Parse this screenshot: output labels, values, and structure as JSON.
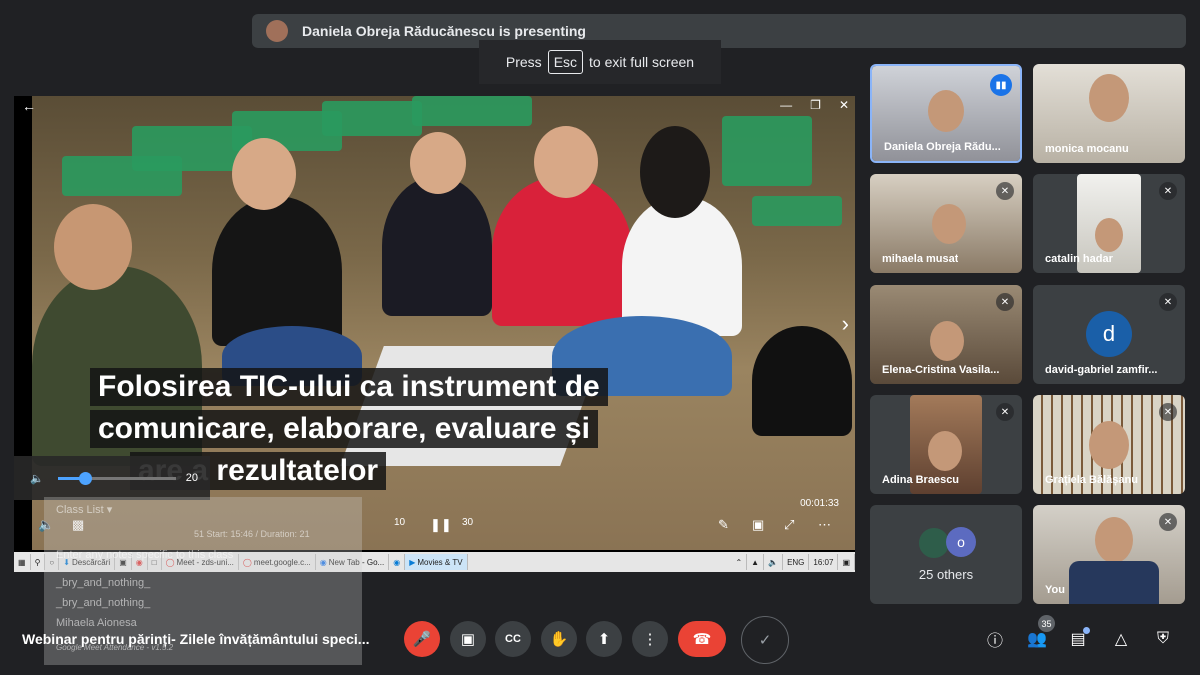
{
  "presenting_bar": {
    "text": "Daniela Obreja Răducănescu is presenting"
  },
  "fullscreen_banner": {
    "press": "Press",
    "key": "Esc",
    "suffix": "to exit full screen"
  },
  "video": {
    "caption_lines": [
      "Folosirea TIC-ului ca instrument de",
      "comunicare, elaborare, evaluare și",
      "are a rezultatelor"
    ],
    "volume_value": "20",
    "volume_level": 0.23,
    "time": "00:01:33",
    "skip_back": "10",
    "skip_forward": "30"
  },
  "attendance_panel": {
    "class_list_label": "Class List",
    "stats": "51  Start: 15:46 / Duration: 21",
    "notes_placeholder": "Enter any notes specific to this class",
    "rows": [
      "_bry_and_nothing_",
      "_bry_and_nothing_",
      "Mihaela Aionesa"
    ],
    "version": "Google Meet Attendance - v1.5.2"
  },
  "taskbar": {
    "items": [
      "Descărcări",
      "Meet - zds-uni...",
      "meet.google.c...",
      "New Tab - Go...",
      "Movies & TV"
    ],
    "lang": "ENG",
    "clock": "16:07"
  },
  "participants": [
    {
      "name": "Daniela Obreja Rădu...",
      "speaking": true
    },
    {
      "name": "monica mocanu"
    },
    {
      "name": "mihaela musat",
      "muted": true
    },
    {
      "name": "catalin hadar",
      "muted": true
    },
    {
      "name": "Elena-Cristina Vasila...",
      "muted": true
    },
    {
      "name": "david-gabriel zamfir...",
      "muted": true,
      "initial": "d",
      "avatar_color": "#1a5fa8"
    },
    {
      "name": "Adina Braescu",
      "muted": true
    },
    {
      "name": "Grațiela Bălășanu",
      "muted": true
    },
    {
      "name": "25 others",
      "initial": "o",
      "avatar_color": "#5c6bc0"
    },
    {
      "name": "You",
      "muted": true
    }
  ],
  "bottom_bar": {
    "meeting_title": "Webinar pentru părinți- Zilele învățământului speci...",
    "people_count": "35",
    "controls": [
      "mic-off-icon",
      "camera-icon",
      "captions-icon",
      "raise-hand-icon",
      "present-icon",
      "more-icon",
      "end-call-icon"
    ]
  }
}
